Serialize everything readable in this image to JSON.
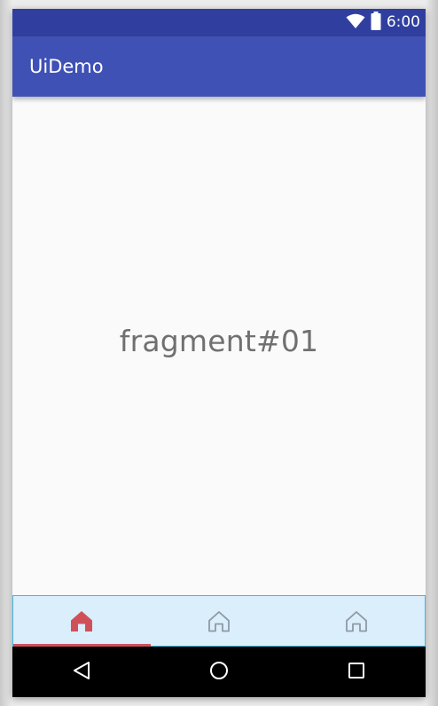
{
  "status_bar": {
    "time": "6:00",
    "icons": [
      "wifi-icon",
      "battery-icon"
    ]
  },
  "app_bar": {
    "title": "UiDemo"
  },
  "content": {
    "fragment_label": "fragment#01"
  },
  "bottom_nav": {
    "selected_index": 0,
    "tabs": [
      {
        "icon": "home-icon",
        "selected": true,
        "color": "#d0505a"
      },
      {
        "icon": "home-outline-icon",
        "selected": false,
        "color": "#8f9aa3"
      },
      {
        "icon": "home-outline-icon",
        "selected": false,
        "color": "#8f9aa3"
      }
    ]
  },
  "system_nav": {
    "buttons": [
      "back-icon",
      "home-circle-icon",
      "recents-icon"
    ]
  },
  "colors": {
    "status_bar": "#303f9f",
    "app_bar": "#3f51b5",
    "bottom_nav_bg": "#dbeefc",
    "bottom_nav_border": "#42b8df",
    "accent": "#d0505a",
    "inactive_icon": "#8f9aa3"
  }
}
